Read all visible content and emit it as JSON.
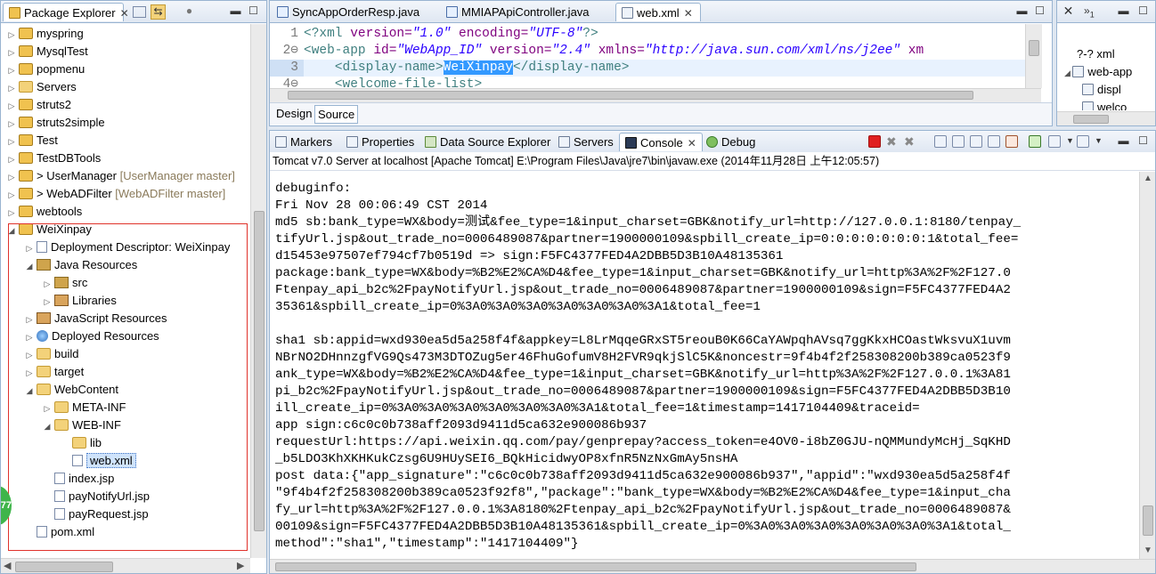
{
  "explorer": {
    "tab": "Package Explorer",
    "close": "✕",
    "items": [
      {
        "label": "myspring",
        "suffix": "",
        "depth": 0,
        "arrow": "▷",
        "icon": "proj"
      },
      {
        "label": "MysqlTest",
        "suffix": "",
        "depth": 0,
        "arrow": "▷",
        "icon": "proj"
      },
      {
        "label": "popmenu",
        "suffix": "",
        "depth": 0,
        "arrow": "▷",
        "icon": "proj"
      },
      {
        "label": "Servers",
        "suffix": "",
        "depth": 0,
        "arrow": "▷",
        "icon": "folder"
      },
      {
        "label": "struts2",
        "suffix": "",
        "depth": 0,
        "arrow": "▷",
        "icon": "proj"
      },
      {
        "label": "struts2simple",
        "suffix": "",
        "depth": 0,
        "arrow": "▷",
        "icon": "proj"
      },
      {
        "label": "Test",
        "suffix": "",
        "depth": 0,
        "arrow": "▷",
        "icon": "proj"
      },
      {
        "label": "TestDBTools",
        "suffix": "",
        "depth": 0,
        "arrow": "▷",
        "icon": "proj"
      },
      {
        "label": "> UserManager",
        "suffix": "[UserManager master]",
        "depth": 0,
        "arrow": "▷",
        "icon": "proj"
      },
      {
        "label": "> WebADFilter",
        "suffix": "[WebADFilter master]",
        "depth": 0,
        "arrow": "▷",
        "icon": "proj"
      },
      {
        "label": "webtools",
        "suffix": "",
        "depth": 0,
        "arrow": "▷",
        "icon": "proj"
      },
      {
        "label": "WeiXinpay",
        "suffix": "",
        "depth": 0,
        "arrow": "◢",
        "icon": "proj"
      },
      {
        "label": "Deployment Descriptor: WeiXinpay",
        "suffix": "",
        "depth": 1,
        "arrow": "▷",
        "icon": "file"
      },
      {
        "label": "Java Resources",
        "suffix": "",
        "depth": 1,
        "arrow": "◢",
        "icon": "pkg"
      },
      {
        "label": "src",
        "suffix": "",
        "depth": 2,
        "arrow": "▷",
        "icon": "pkg"
      },
      {
        "label": "Libraries",
        "suffix": "",
        "depth": 2,
        "arrow": "▷",
        "icon": "lib"
      },
      {
        "label": "JavaScript Resources",
        "suffix": "",
        "depth": 1,
        "arrow": "▷",
        "icon": "lib"
      },
      {
        "label": "Deployed Resources",
        "suffix": "",
        "depth": 1,
        "arrow": "▷",
        "icon": "globe"
      },
      {
        "label": "build",
        "suffix": "",
        "depth": 1,
        "arrow": "▷",
        "icon": "folder"
      },
      {
        "label": "target",
        "suffix": "",
        "depth": 1,
        "arrow": "▷",
        "icon": "folder"
      },
      {
        "label": "WebContent",
        "suffix": "",
        "depth": 1,
        "arrow": "◢",
        "icon": "folder"
      },
      {
        "label": "META-INF",
        "suffix": "",
        "depth": 2,
        "arrow": "▷",
        "icon": "folder"
      },
      {
        "label": "WEB-INF",
        "suffix": "",
        "depth": 2,
        "arrow": "◢",
        "icon": "folder"
      },
      {
        "label": "lib",
        "suffix": "",
        "depth": 3,
        "arrow": "",
        "icon": "folder"
      },
      {
        "label": "web.xml",
        "suffix": "",
        "depth": 3,
        "arrow": "",
        "icon": "file",
        "selected": true
      },
      {
        "label": "index.jsp",
        "suffix": "",
        "depth": 2,
        "arrow": "",
        "icon": "file"
      },
      {
        "label": "payNotifyUrl.jsp",
        "suffix": "",
        "depth": 2,
        "arrow": "",
        "icon": "file"
      },
      {
        "label": "payRequest.jsp",
        "suffix": "",
        "depth": 2,
        "arrow": "",
        "icon": "file"
      },
      {
        "label": "pom.xml",
        "suffix": "",
        "depth": 1,
        "arrow": "",
        "icon": "file"
      }
    ]
  },
  "editor": {
    "tabs": [
      {
        "label": "SyncAppOrderResp.java",
        "active": false
      },
      {
        "label": "MMIAPApiController.java",
        "active": false
      },
      {
        "label": "web.xml",
        "active": true
      }
    ],
    "close": "✕",
    "lines": [
      {
        "num": "1",
        "pre": "<?",
        "tag": "xml",
        "attr1": " version=",
        "val1": "\"1.0\"",
        "attr2": " encoding=",
        "val2": "\"UTF-8\"",
        "post": "?>"
      },
      {
        "num": "2⊖",
        "pre": "<",
        "tag": "web-app",
        "attr1": " id=",
        "val1": "\"WebApp_ID\"",
        "attr2": " version=",
        "val2": "\"2.4\"",
        "attr3": " xmlns=",
        "val3": "\"http://java.sun.com/xml/ns/j2ee\"",
        "post": " xm"
      },
      {
        "num": "3",
        "indent": "    ",
        "open": "<display-name>",
        "selected": "WeiXinpay",
        "close": "</display-name>"
      },
      {
        "num": "4⊖",
        "indent": "    ",
        "open": "<welcome-file-list>"
      }
    ],
    "design_tab": "Design",
    "source_tab": "Source"
  },
  "outline": {
    "tab_prefix": "»",
    "tab_count": "1",
    "items": [
      {
        "label": "?-? xml"
      },
      {
        "label": "web-app"
      },
      {
        "label": "displ"
      },
      {
        "label": "welco"
      }
    ]
  },
  "bottom": {
    "tabs": [
      "Markers",
      "Properties",
      "Data Source Explorer",
      "Servers",
      "Console",
      "Debug"
    ],
    "active_tab": "Console",
    "close": "✕",
    "title": "Tomcat v7.0 Server at localhost [Apache Tomcat] E:\\Program Files\\Java\\jre7\\bin\\javaw.exe (2014年11月28日 上午12:05:57)",
    "console_lines": [
      "debuginfo:",
      "Fri Nov 28 00:06:49 CST 2014",
      "md5 sb:bank_type=WX&body=测试&fee_type=1&input_charset=GBK&notify_url=http://127.0.0.1:8180/tenpay_",
      "tifyUrl.jsp&out_trade_no=0006489087&partner=1900000109&spbill_create_ip=0:0:0:0:0:0:0:1&total_fee=",
      "d15453e97507ef794cf7b0519d => sign:F5FC4377FED4A2DBB5D3B10A48135361",
      "package:bank_type=WX&body=%B2%E2%CA%D4&fee_type=1&input_charset=GBK&notify_url=http%3A%2F%2F127.0",
      "Ftenpay_api_b2c%2FpayNotifyUrl.jsp&out_trade_no=0006489087&partner=1900000109&sign=F5FC4377FED4A2",
      "35361&spbill_create_ip=0%3A0%3A0%3A0%3A0%3A0%3A0%3A1&total_fee=1",
      "",
      "sha1 sb:appid=wxd930ea5d5a258f4f&appkey=L8LrMqqeGRxST5reouB0K66CaYAWpqhAVsq7ggKkxHCOastWksvuX1uvm",
      "NBrNO2DHnnzgfVG9Qs473M3DTOZug5er46FhuGofumV8H2FVR9qkjSlC5K&noncestr=9f4b4f2f258308200b389ca0523f9",
      "ank_type=WX&body=%B2%E2%CA%D4&fee_type=1&input_charset=GBK&notify_url=http%3A%2F%2F127.0.0.1%3A81",
      "pi_b2c%2FpayNotifyUrl.jsp&out_trade_no=0006489087&partner=1900000109&sign=F5FC4377FED4A2DBB5D3B10",
      "ill_create_ip=0%3A0%3A0%3A0%3A0%3A0%3A0%3A1&total_fee=1&timestamp=1417104409&traceid=",
      "app sign:c6c0c0b738aff2093d9411d5ca632e900086b937",
      "requestUrl:https://api.weixin.qq.com/pay/genprepay?access_token=e4OV0-i8bZ0GJU-nQMMundyMcHj_SqKHD",
      "_b5LDO3KhXKHKukCzsg6U9HUySEI6_BQkHicidwyOP8xfnR5NzNxGmAy5nsHA",
      "post data:{\"app_signature\":\"c6c0c0b738aff2093d9411d5ca632e900086b937\",\"appid\":\"wxd930ea5d5a258f4f",
      "\"9f4b4f2f258308200b389ca0523f92f8\",\"package\":\"bank_type=WX&body=%B2%E2%CA%D4&fee_type=1&input_cha",
      "fy_url=http%3A%2F%2F127.0.0.1%3A8180%2Ftenpay_api_b2c%2FpayNotifyUrl.jsp&out_trade_no=0006489087&",
      "00109&sign=F5FC4377FED4A2DBB5D3B10A48135361&spbill_create_ip=0%3A0%3A0%3A0%3A0%3A0%3A0%3A1&total_",
      "method\":\"sha1\",\"timestamp\":\"1417104409\"}"
    ]
  },
  "colors": {
    "accent": "#3399ff",
    "redbox": "#e0322b",
    "stop": "#e02020"
  }
}
